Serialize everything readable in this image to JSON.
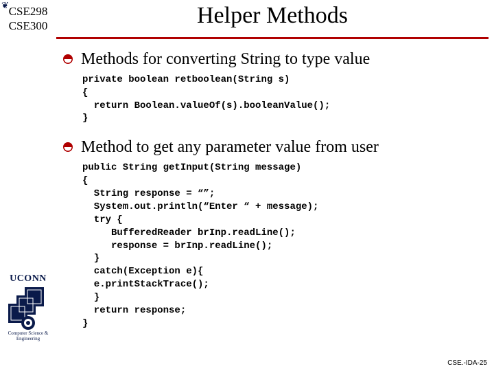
{
  "sidebar": {
    "course1": "CSE298",
    "course2": "CSE300"
  },
  "title": "Helper Methods",
  "bullets": [
    {
      "label": "Methods for converting String to type value",
      "code": "private boolean retboolean(String s)\n{\n  return Boolean.valueOf(s).booleanValue();\n}"
    },
    {
      "label": "Method to get any parameter value from user",
      "code": "public String getInput(String message)\n{\n  String response = “”;\n  System.out.println(“Enter “ + message);\n  try {\n     BufferedReader brInp.readLine();\n     response = brInp.readLine();\n  }\n  catch(Exception e){\n  e.printStackTrace();\n  }\n  return response;\n}"
    }
  ],
  "logo": {
    "word": "UCONN",
    "sub": "Computer Science & Engineering"
  },
  "footer": "CSE.-IDA-25"
}
